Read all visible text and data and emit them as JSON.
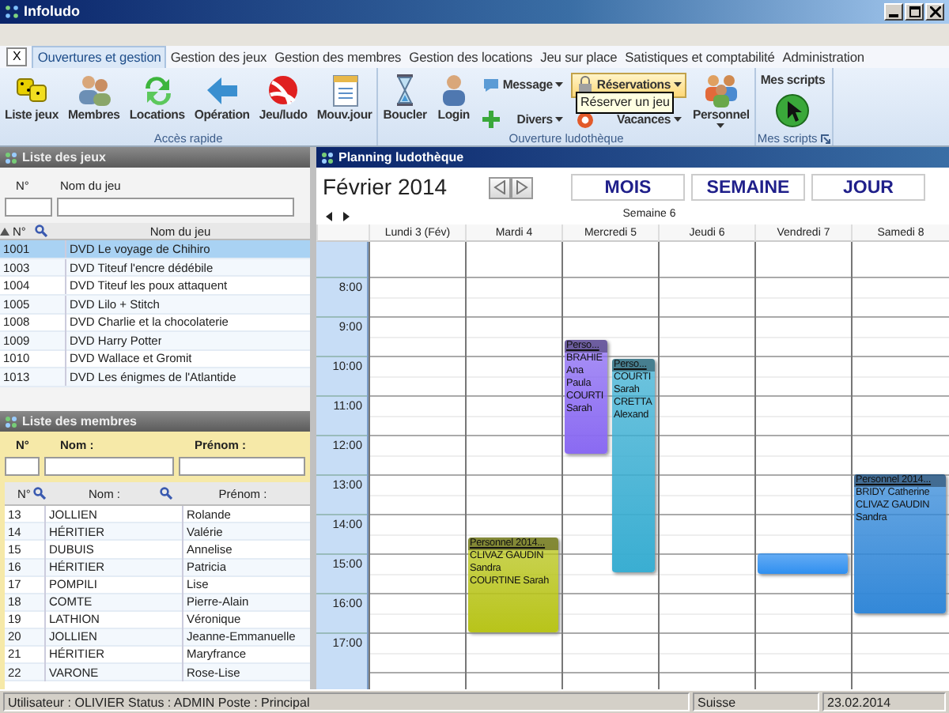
{
  "window": {
    "title": "Infoludo"
  },
  "close_tab": "X",
  "tabs": [
    {
      "label": "Ouvertures et gestion",
      "selected": true
    },
    {
      "label": "Gestion des jeux",
      "selected": false
    },
    {
      "label": "Gestion des membres",
      "selected": false
    },
    {
      "label": "Gestion des locations",
      "selected": false
    },
    {
      "label": "Jeu sur place",
      "selected": false
    },
    {
      "label": "Satistiques et comptabilité",
      "selected": false
    },
    {
      "label": "Administration",
      "selected": false
    }
  ],
  "ribbon": {
    "groups": [
      {
        "label": "Accès rapide",
        "items": [
          {
            "kind": "large",
            "label": "Liste jeux",
            "dropdown": false
          },
          {
            "kind": "large",
            "label": "Membres",
            "dropdown": false
          },
          {
            "kind": "large",
            "label": "Locations",
            "dropdown": false
          },
          {
            "kind": "large",
            "label": "Opération",
            "dropdown": false
          },
          {
            "kind": "large",
            "label": "Jeu/ludo",
            "dropdown": false
          },
          {
            "kind": "large",
            "label": "Mouv.jour",
            "dropdown": false
          }
        ]
      },
      {
        "label": "Ouverture ludothèque",
        "items": [
          {
            "kind": "large",
            "label": "Boucler",
            "dropdown": false
          },
          {
            "kind": "large",
            "label": "Login",
            "dropdown": false
          },
          {
            "kind": "stack",
            "items": [
              {
                "label": "Message",
                "highlighted": false
              },
              {
                "label": "Divers",
                "highlighted": false
              }
            ]
          },
          {
            "kind": "stack",
            "items": [
              {
                "label": "Réservations",
                "highlighted": true
              },
              {
                "label": "Vacances",
                "highlighted": false
              }
            ]
          },
          {
            "kind": "large",
            "label": "Personnel",
            "dropdown": true
          }
        ]
      },
      {
        "label": "Mes scripts",
        "launcher": true,
        "items": [
          {
            "kind": "top",
            "label": "Mes scripts",
            "dropdown": false
          }
        ]
      }
    ],
    "tooltip": "Réserver un jeu"
  },
  "games_panel": {
    "title": "Liste des jeux",
    "filter_labels": [
      "N°",
      "Nom du jeu"
    ],
    "columns": [
      "N°",
      "Nom du jeu"
    ],
    "rows": [
      {
        "number": "1001",
        "name": "DVD Le voyage de Chihiro",
        "selected": true
      },
      {
        "number": "1003",
        "name": "DVD Titeuf l'encre dédébile",
        "selected": false
      },
      {
        "number": "1004",
        "name": "DVD Titeuf les poux attaquent",
        "selected": false
      },
      {
        "number": "1005",
        "name": "DVD Lilo + Stitch",
        "selected": false
      },
      {
        "number": "1008",
        "name": "DVD Charlie et la chocolaterie",
        "selected": false
      },
      {
        "number": "1009",
        "name": "DVD Harry Potter",
        "selected": false
      },
      {
        "number": "1010",
        "name": "DVD Wallace et Gromit",
        "selected": false
      },
      {
        "number": "1013",
        "name": "DVD Les énigmes de l'Atlantide",
        "selected": false
      }
    ]
  },
  "members_panel": {
    "title": "Liste des membres",
    "filter_labels": [
      "N°",
      "Nom :",
      "Prénom :"
    ],
    "columns": [
      "N°",
      "Nom :",
      "Prénom :"
    ],
    "rows": [
      {
        "number": "13",
        "last_name": "JOLLIEN",
        "first_name": "Rolande"
      },
      {
        "number": "14",
        "last_name": "HÉRITIER",
        "first_name": "Valérie"
      },
      {
        "number": "15",
        "last_name": "DUBUIS",
        "first_name": "Annelise"
      },
      {
        "number": "16",
        "last_name": "HÉRITIER",
        "first_name": "Patricia"
      },
      {
        "number": "17",
        "last_name": "POMPILI",
        "first_name": "Lise"
      },
      {
        "number": "18",
        "last_name": "COMTE",
        "first_name": "Pierre-Alain"
      },
      {
        "number": "19",
        "last_name": "LATHION",
        "first_name": "Véronique"
      },
      {
        "number": "20",
        "last_name": "JOLLIEN",
        "first_name": "Jeanne-Emmanuelle"
      },
      {
        "number": "21",
        "last_name": "HÉRITIER",
        "first_name": "Maryfrance"
      },
      {
        "number": "22",
        "last_name": "VARONE",
        "first_name": "Rose-Lise"
      }
    ]
  },
  "planning": {
    "title": "Planning ludothèque",
    "month": "Février 2014",
    "views": [
      {
        "label": "MOIS"
      },
      {
        "label": "SEMAINE"
      },
      {
        "label": "JOUR"
      }
    ],
    "week": "Semaine 6",
    "hours": [
      "8:00",
      "9:00",
      "10:00",
      "11:00",
      "12:00",
      "13:00",
      "14:00",
      "15:00",
      "16:00",
      "17:00"
    ],
    "days": [
      {
        "label": "Lundi 3 (Fév)"
      },
      {
        "label": "Mardi 4",
        "events": [
          {
            "color": "#b8c41a",
            "title": "Personnel 2014...",
            "lines": [
              "CLIVAZ GAUDIN",
              "Sandra",
              "COURTINE Sarah"
            ]
          }
        ]
      },
      {
        "label": "Mercredi 5",
        "events": [
          {
            "color": "#8a6af2",
            "title": "Perso...",
            "lines": [
              "BRAHIE",
              "Ana",
              "Paula",
              "COURTI",
              "Sarah"
            ]
          },
          {
            "color": "#3aaed2",
            "title": "Perso...",
            "lines": [
              "COURTI",
              "Sarah",
              "CRETTA",
              "Alexand"
            ]
          }
        ]
      },
      {
        "label": "Jeudi 6"
      },
      {
        "label": "Vendredi 7",
        "events": [
          {
            "color": "#2f8ff0"
          }
        ]
      },
      {
        "label": "Samedi 8",
        "events": [
          {
            "color": "#3388d8",
            "title": "Personnel 2014...",
            "lines": [
              "BRIDY Catherine",
              "CLIVAZ GAUDIN",
              "Sandra"
            ]
          }
        ]
      }
    ]
  },
  "status_bar": {
    "user": "Utilisateur : OLIVIER Status : ADMIN Poste : Principal",
    "region": "Suisse",
    "date": "23.02.2014"
  }
}
